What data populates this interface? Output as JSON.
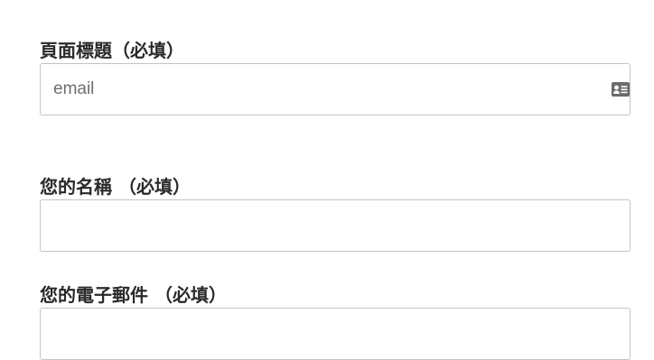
{
  "form": {
    "fields": [
      {
        "label": "頁面標題（必填）",
        "placeholder": "email",
        "value": "",
        "icon": "contact-card-icon"
      },
      {
        "label": "您的名稱 （必填）",
        "placeholder": "",
        "value": ""
      },
      {
        "label": "您的電子郵件 （必填）",
        "placeholder": "",
        "value": ""
      }
    ]
  },
  "colors": {
    "label_text": "#2a2a2a",
    "input_border": "#c4c4c4",
    "placeholder_text": "#6e6e6e",
    "icon_fill": "#6b6b6b"
  }
}
